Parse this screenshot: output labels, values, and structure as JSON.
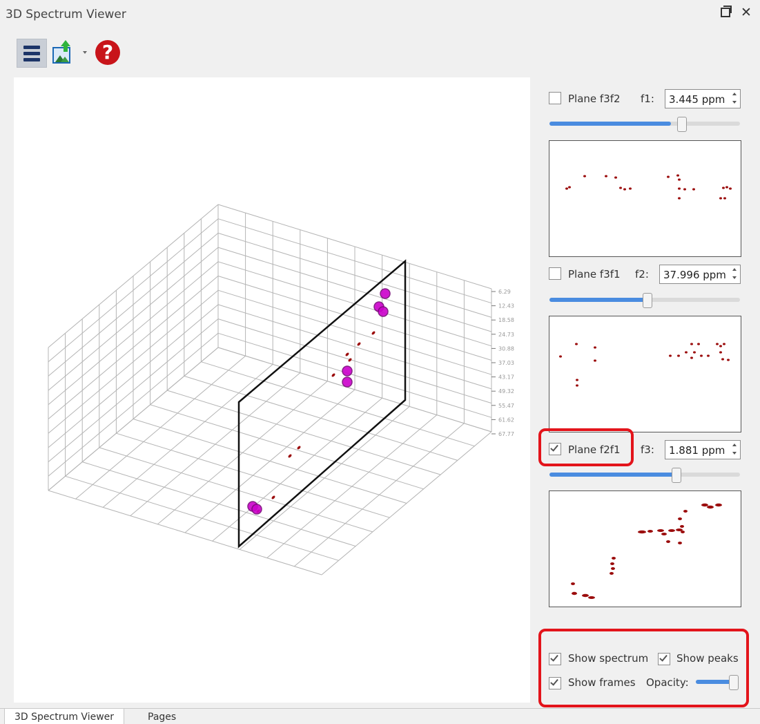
{
  "window": {
    "title": "3D Spectrum Viewer"
  },
  "toolbar": {
    "menu_icon": "menu-icon",
    "export_icon": "export-image-icon",
    "help_icon": "help-icon",
    "help_glyph": "?"
  },
  "planes": [
    {
      "label": "Plane f3f2",
      "checked": false,
      "axis_label": "f1:",
      "value": "3.445 ppm",
      "slider_fraction": 0.63
    },
    {
      "label": "Plane f3f1",
      "checked": false,
      "axis_label": "f2:",
      "value": "37.996 ppm",
      "slider_fraction": 0.51
    },
    {
      "label": "Plane f2f1",
      "checked": true,
      "axis_label": "f3:",
      "value": "1.881 ppm",
      "slider_fraction": 0.66
    }
  ],
  "options": {
    "show_spectrum": {
      "label": "Show spectrum",
      "checked": true
    },
    "show_peaks": {
      "label": "Show peaks",
      "checked": true
    },
    "show_frames": {
      "label": "Show frames",
      "checked": true
    },
    "opacity": {
      "label": "Opacity:",
      "fraction": 0.95
    }
  },
  "axis_ticks_right": [
    "6.29",
    "12.43",
    "18.58",
    "24.73",
    "30.88",
    "37.03",
    "43.17",
    "49.32",
    "55.47",
    "61.62",
    "67.77"
  ],
  "colors": {
    "accent": "#4a8ce0",
    "highlight": "#e3141b",
    "peak": "#cc00cc",
    "spectrum": "#9b0d0d"
  },
  "tabs": [
    {
      "label": "3D Spectrum Viewer",
      "active": true
    },
    {
      "label": "Pages",
      "active": false
    }
  ]
}
